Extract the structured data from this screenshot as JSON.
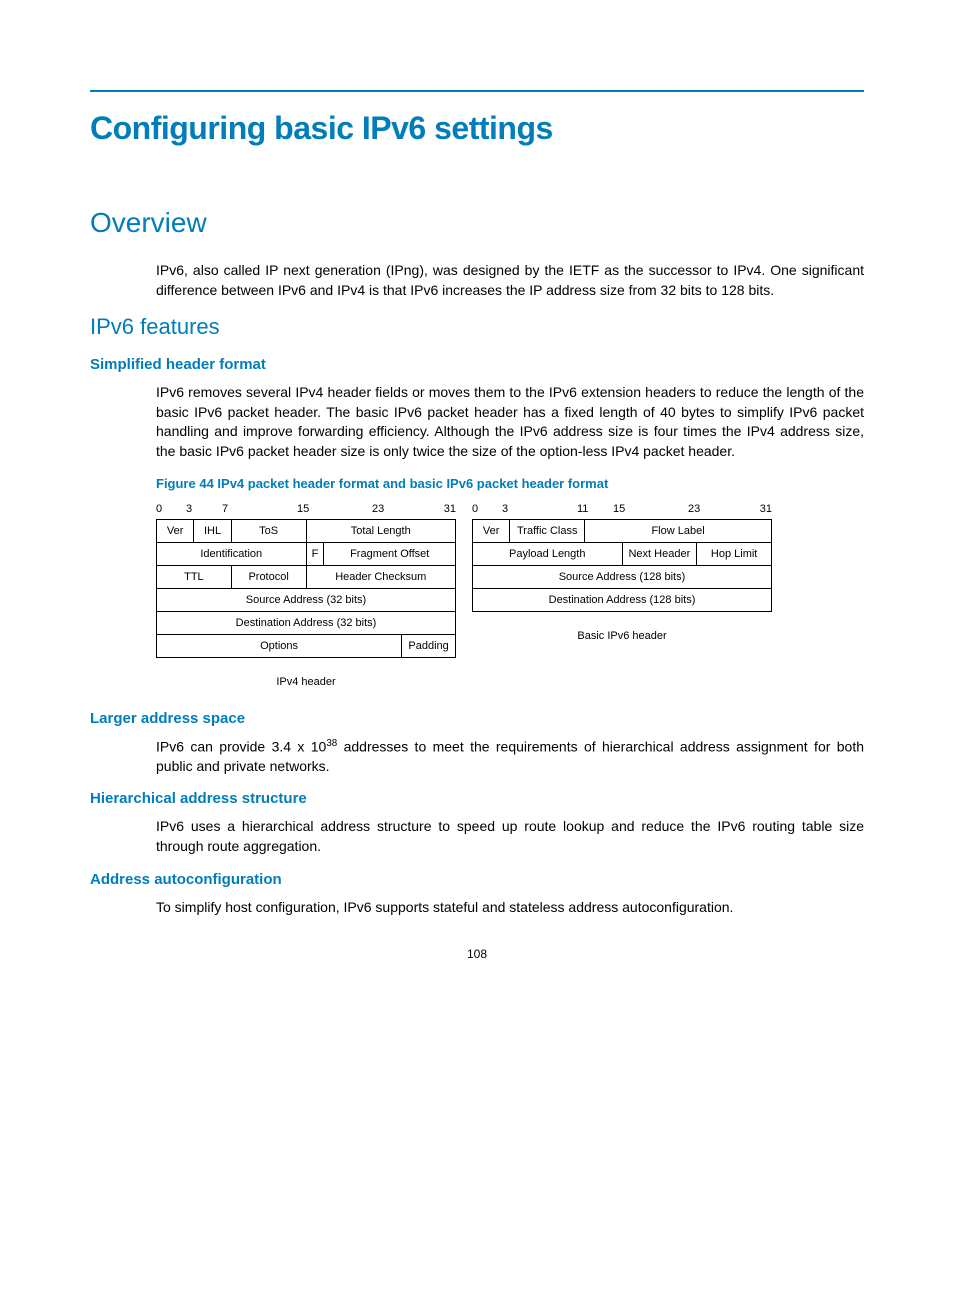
{
  "title": "Configuring basic IPv6 settings",
  "h_overview": "Overview",
  "p_overview": "IPv6, also called IP next generation (IPng), was designed by the IETF as the successor to IPv4. One significant difference between IPv6 and IPv4 is that IPv6 increases the IP address size from 32 bits to 128 bits.",
  "h_features": "IPv6 features",
  "h_simplified": "Simplified header format",
  "p_simplified": "IPv6 removes several IPv4 header fields or moves them to the IPv6 extension headers to reduce the length of the basic IPv6 packet header. The basic IPv6 packet header has a fixed length of 40 bytes to simplify IPv6 packet handling and improve forwarding efficiency. Although the IPv6 address size is four times the IPv4 address size, the basic IPv6 packet header size is only twice the size of the option-less IPv4 packet header.",
  "fig_caption": "Figure 44 IPv4 packet header format and basic IPv6 packet header format",
  "ipv4": {
    "bits": {
      "b0": "0",
      "b3": "3",
      "b7": "7",
      "b15": "15",
      "b23": "23",
      "b31": "31"
    },
    "ver": "Ver",
    "ihl": "IHL",
    "tos": "ToS",
    "total": "Total Length",
    "ident": "Identification",
    "f": "F",
    "frag": "Fragment Offset",
    "ttl": "TTL",
    "proto": "Protocol",
    "chk": "Header Checksum",
    "src": "Source Address (32 bits)",
    "dst": "Destination Address (32 bits)",
    "opt": "Options",
    "pad": "Padding",
    "caption": "IPv4 header"
  },
  "ipv6": {
    "bits": {
      "b0": "0",
      "b3": "3",
      "b11": "11",
      "b15": "15",
      "b23": "23",
      "b31": "31"
    },
    "ver": "Ver",
    "tc": "Traffic Class",
    "flow": "Flow Label",
    "pl": "Payload Length",
    "nh": "Next Header",
    "hl": "Hop Limit",
    "src": "Source Address (128 bits)",
    "dst": "Destination Address (128 bits)",
    "caption": "Basic IPv6 header"
  },
  "h_larger": "Larger address space",
  "p_larger_pre": "IPv6 can provide 3.4 x 10",
  "p_larger_exp": "38",
  "p_larger_post": " addresses to meet the requirements of hierarchical address assignment for both public and private networks.",
  "h_hier": "Hierarchical address structure",
  "p_hier": "IPv6 uses a hierarchical address structure to speed up route lookup and reduce the IPv6 routing table size through route aggregation.",
  "h_auto": "Address autoconfiguration",
  "p_auto": "To simplify host configuration, IPv6 supports stateful and stateless address autoconfiguration.",
  "page_number": "108"
}
